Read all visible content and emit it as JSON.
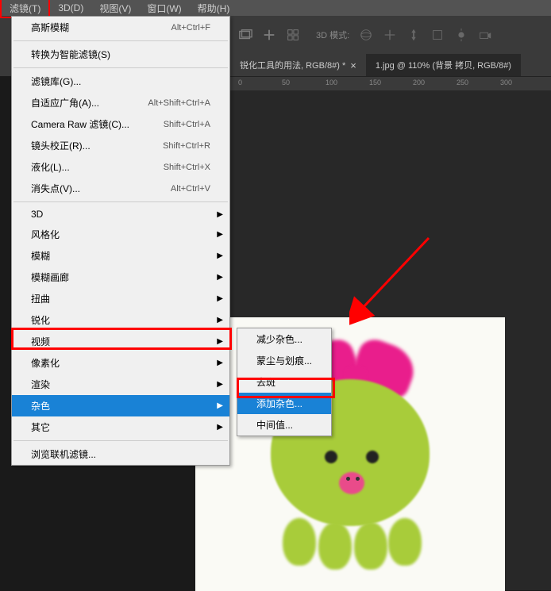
{
  "menubar": {
    "items": [
      {
        "label": "滤镜(T)",
        "active": true
      },
      {
        "label": "3D(D)"
      },
      {
        "label": "视图(V)"
      },
      {
        "label": "窗口(W)"
      },
      {
        "label": "帮助(H)"
      }
    ]
  },
  "toolbar": {
    "mode_label": "3D 模式:"
  },
  "tabs": [
    {
      "title": "锐化工具的用法, RGB/8#) *",
      "active": false
    },
    {
      "title": "1.jpg @ 110% (背景 拷贝, RGB/8#)",
      "active": true
    }
  ],
  "ruler_ticks": [
    "0",
    "50",
    "100",
    "150",
    "200",
    "250",
    "300"
  ],
  "filter_menu": {
    "items": [
      {
        "label": "高斯模糊",
        "shortcut": "Alt+Ctrl+F"
      },
      {
        "sep": true
      },
      {
        "label": "转换为智能滤镜(S)"
      },
      {
        "sep": true
      },
      {
        "label": "滤镜库(G)..."
      },
      {
        "label": "自适应广角(A)...",
        "shortcut": "Alt+Shift+Ctrl+A"
      },
      {
        "label": "Camera Raw 滤镜(C)...",
        "shortcut": "Shift+Ctrl+A"
      },
      {
        "label": "镜头校正(R)...",
        "shortcut": "Shift+Ctrl+R"
      },
      {
        "label": "液化(L)...",
        "shortcut": "Shift+Ctrl+X"
      },
      {
        "label": "消失点(V)...",
        "shortcut": "Alt+Ctrl+V"
      },
      {
        "sep": true
      },
      {
        "label": "3D",
        "submenu": true
      },
      {
        "label": "风格化",
        "submenu": true
      },
      {
        "label": "模糊",
        "submenu": true
      },
      {
        "label": "模糊画廊",
        "submenu": true
      },
      {
        "label": "扭曲",
        "submenu": true
      },
      {
        "label": "锐化",
        "submenu": true
      },
      {
        "label": "视频",
        "submenu": true
      },
      {
        "label": "像素化",
        "submenu": true
      },
      {
        "label": "渲染",
        "submenu": true
      },
      {
        "label": "杂色",
        "submenu": true,
        "highlighted": true
      },
      {
        "label": "其它",
        "submenu": true
      },
      {
        "sep": true
      },
      {
        "label": "浏览联机滤镜..."
      }
    ]
  },
  "noise_submenu": {
    "items": [
      {
        "label": "减少杂色..."
      },
      {
        "label": "蒙尘与划痕..."
      },
      {
        "label": "去斑"
      },
      {
        "label": "添加杂色...",
        "highlighted": true
      },
      {
        "label": "中间值..."
      }
    ]
  }
}
